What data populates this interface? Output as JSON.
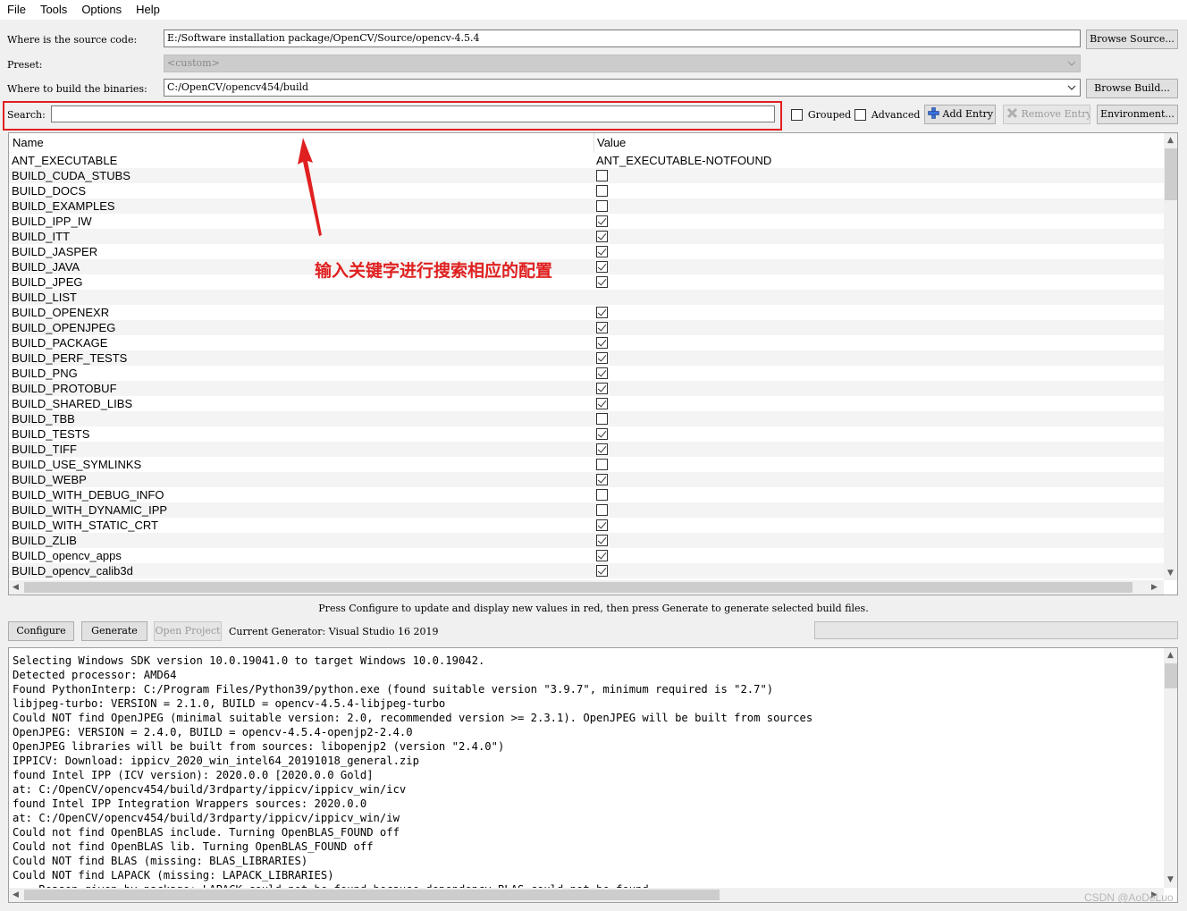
{
  "menu": [
    "File",
    "Tools",
    "Options",
    "Help"
  ],
  "source": {
    "label": "Where is the source code:",
    "value": "E:/Software installation package/OpenCV/Source/opencv-4.5.4",
    "browse": "Browse Source..."
  },
  "preset": {
    "label": "Preset:",
    "value": "<custom>"
  },
  "build": {
    "label": "Where to build the binaries:",
    "value": "C:/OpenCV/opencv454/build",
    "browse": "Browse Build..."
  },
  "search": {
    "label": "Search:",
    "value": ""
  },
  "options": {
    "grouped": "Grouped",
    "advanced": "Advanced",
    "add_entry": "Add Entry",
    "remove_entry": "Remove Entry",
    "environment": "Environment..."
  },
  "table": {
    "col_name": "Name",
    "col_value": "Value",
    "rows": [
      {
        "name": "ANT_EXECUTABLE",
        "text": "ANT_EXECUTABLE-NOTFOUND"
      },
      {
        "name": "BUILD_CUDA_STUBS",
        "checked": false
      },
      {
        "name": "BUILD_DOCS",
        "checked": false
      },
      {
        "name": "BUILD_EXAMPLES",
        "checked": false
      },
      {
        "name": "BUILD_IPP_IW",
        "checked": true
      },
      {
        "name": "BUILD_ITT",
        "checked": true
      },
      {
        "name": "BUILD_JASPER",
        "checked": true
      },
      {
        "name": "BUILD_JAVA",
        "checked": true
      },
      {
        "name": "BUILD_JPEG",
        "checked": true
      },
      {
        "name": "BUILD_LIST",
        "text": ""
      },
      {
        "name": "BUILD_OPENEXR",
        "checked": true
      },
      {
        "name": "BUILD_OPENJPEG",
        "checked": true
      },
      {
        "name": "BUILD_PACKAGE",
        "checked": true
      },
      {
        "name": "BUILD_PERF_TESTS",
        "checked": true
      },
      {
        "name": "BUILD_PNG",
        "checked": true
      },
      {
        "name": "BUILD_PROTOBUF",
        "checked": true
      },
      {
        "name": "BUILD_SHARED_LIBS",
        "checked": true
      },
      {
        "name": "BUILD_TBB",
        "checked": false
      },
      {
        "name": "BUILD_TESTS",
        "checked": true
      },
      {
        "name": "BUILD_TIFF",
        "checked": true
      },
      {
        "name": "BUILD_USE_SYMLINKS",
        "checked": false
      },
      {
        "name": "BUILD_WEBP",
        "checked": true
      },
      {
        "name": "BUILD_WITH_DEBUG_INFO",
        "checked": false
      },
      {
        "name": "BUILD_WITH_DYNAMIC_IPP",
        "checked": false
      },
      {
        "name": "BUILD_WITH_STATIC_CRT",
        "checked": true
      },
      {
        "name": "BUILD_ZLIB",
        "checked": true
      },
      {
        "name": "BUILD_opencv_apps",
        "checked": true
      },
      {
        "name": "BUILD_opencv_calib3d",
        "checked": true
      }
    ]
  },
  "annotation": "输入关键字进行搜索相应的配置",
  "annotation_color": "#e02020",
  "hint": "Press Configure to update and display new values in red, then press Generate to generate selected build files.",
  "actions": {
    "configure": "Configure",
    "generate": "Generate",
    "open_project": "Open Project",
    "generator": "Current Generator: Visual Studio 16 2019"
  },
  "log_lines": [
    "Selecting Windows SDK version 10.0.19041.0 to target Windows 10.0.19042.",
    "Detected processor: AMD64",
    "Found PythonInterp: C:/Program Files/Python39/python.exe (found suitable version \"3.9.7\", minimum required is \"2.7\")",
    "libjpeg-turbo: VERSION = 2.1.0, BUILD = opencv-4.5.4-libjpeg-turbo",
    "Could NOT find OpenJPEG (minimal suitable version: 2.0, recommended version >= 2.3.1). OpenJPEG will be built from sources",
    "OpenJPEG: VERSION = 2.4.0, BUILD = opencv-4.5.4-openjp2-2.4.0",
    "OpenJPEG libraries will be built from sources: libopenjp2 (version \"2.4.0\")",
    "IPPICV: Download: ippicv_2020_win_intel64_20191018_general.zip",
    "found Intel IPP (ICV version): 2020.0.0 [2020.0.0 Gold]",
    "at: C:/OpenCV/opencv454/build/3rdparty/ippicv/ippicv_win/icv",
    "found Intel IPP Integration Wrappers sources: 2020.0.0",
    "at: C:/OpenCV/opencv454/build/3rdparty/ippicv/ippicv_win/iw",
    "Could not find OpenBLAS include. Turning OpenBLAS_FOUND off",
    "Could not find OpenBLAS lib. Turning OpenBLAS_FOUND off",
    "Could NOT find BLAS (missing: BLAS_LIBRARIES)",
    "Could NOT find LAPACK (missing: LAPACK_LIBRARIES)",
    "    Reason given by package: LAPACK could not be found because dependency BLAS could not be found"
  ],
  "watermark": "CSDN @AoDeLuo"
}
